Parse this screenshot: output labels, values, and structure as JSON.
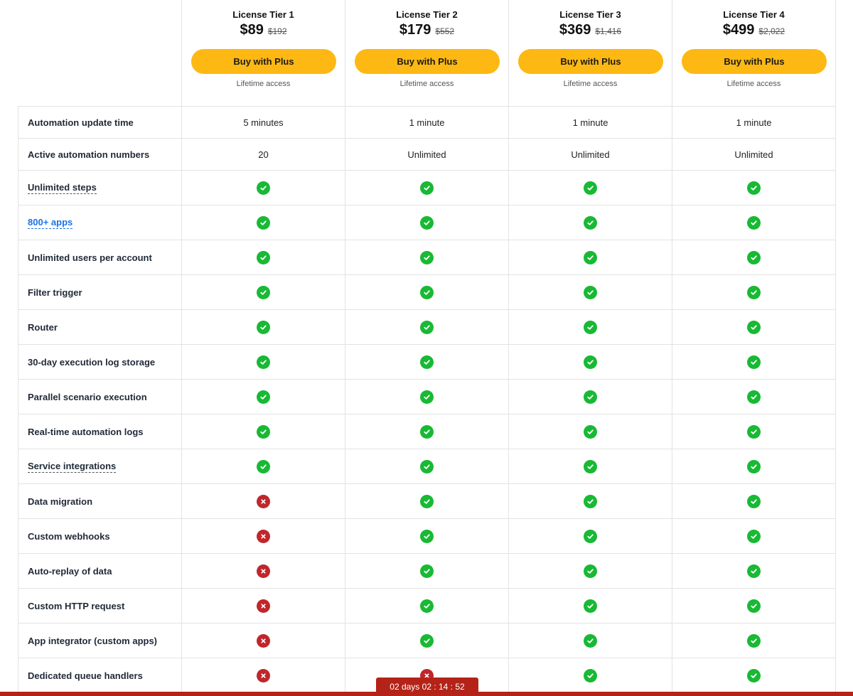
{
  "tiers": [
    {
      "name": "License Tier 1",
      "price": "$89",
      "old_price": "$192",
      "button": "Buy with Plus",
      "note": "Lifetime access"
    },
    {
      "name": "License Tier 2",
      "price": "$179",
      "old_price": "$552",
      "button": "Buy with Plus",
      "note": "Lifetime access"
    },
    {
      "name": "License Tier 3",
      "price": "$369",
      "old_price": "$1,416",
      "button": "Buy with Plus",
      "note": "Lifetime access"
    },
    {
      "name": "License Tier 4",
      "price": "$499",
      "old_price": "$2,022",
      "button": "Buy with Plus",
      "note": "Lifetime access"
    }
  ],
  "features": [
    {
      "label": "Automation update time",
      "style": "plain",
      "values": [
        "5 minutes",
        "1 minute",
        "1 minute",
        "1 minute"
      ]
    },
    {
      "label": "Active automation numbers",
      "style": "plain",
      "values": [
        "20",
        "Unlimited",
        "Unlimited",
        "Unlimited"
      ]
    },
    {
      "label": "Unlimited steps",
      "style": "dotted",
      "values": [
        true,
        true,
        true,
        true
      ]
    },
    {
      "label": "800+ apps",
      "style": "link",
      "values": [
        true,
        true,
        true,
        true
      ]
    },
    {
      "label": "Unlimited users per account",
      "style": "plain",
      "values": [
        true,
        true,
        true,
        true
      ]
    },
    {
      "label": "Filter trigger",
      "style": "plain",
      "values": [
        true,
        true,
        true,
        true
      ]
    },
    {
      "label": "Router",
      "style": "plain",
      "values": [
        true,
        true,
        true,
        true
      ]
    },
    {
      "label": "30-day execution log storage",
      "style": "plain",
      "values": [
        true,
        true,
        true,
        true
      ]
    },
    {
      "label": "Parallel scenario execution",
      "style": "plain",
      "values": [
        true,
        true,
        true,
        true
      ]
    },
    {
      "label": "Real-time automation logs",
      "style": "plain",
      "values": [
        true,
        true,
        true,
        true
      ]
    },
    {
      "label": "Service integrations",
      "style": "dotted",
      "values": [
        true,
        true,
        true,
        true
      ]
    },
    {
      "label": "Data migration",
      "style": "plain",
      "values": [
        false,
        true,
        true,
        true
      ]
    },
    {
      "label": "Custom webhooks",
      "style": "plain",
      "values": [
        false,
        true,
        true,
        true
      ]
    },
    {
      "label": "Auto-replay of data",
      "style": "plain",
      "values": [
        false,
        true,
        true,
        true
      ]
    },
    {
      "label": "Custom HTTP request",
      "style": "plain",
      "values": [
        false,
        true,
        true,
        true
      ]
    },
    {
      "label": "App integrator (custom apps)",
      "style": "plain",
      "values": [
        false,
        true,
        true,
        true
      ]
    },
    {
      "label": "Dedicated queue handlers",
      "style": "plain",
      "values": [
        false,
        false,
        true,
        true
      ]
    }
  ],
  "countdown": {
    "text": "02 days  02 : 14 : 52"
  },
  "colors": {
    "accent": "#fdb813",
    "check": "#18b934",
    "cross": "#c0262b",
    "timer": "#b42318"
  },
  "icons": {
    "yes": "check-circle-icon",
    "no": "x-circle-icon"
  }
}
